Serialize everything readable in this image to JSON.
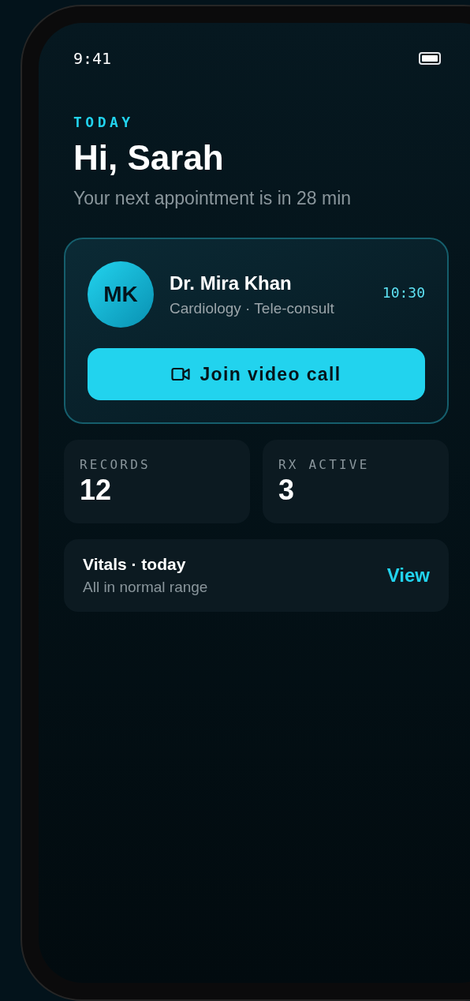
{
  "status_bar": {
    "time": "9:41"
  },
  "header": {
    "eyebrow": "TODAY",
    "greeting": "Hi, Sarah",
    "subtitle": "Your next appointment is in 28 min"
  },
  "appointment": {
    "initials": "MK",
    "doctor": "Dr. Mira Khan",
    "details": "Cardiology · Tele-consult",
    "time": "10:30",
    "action": "Join video call"
  },
  "stats": [
    {
      "label": "RECORDS",
      "value": "12"
    },
    {
      "label": "RX ACTIVE",
      "value": "3"
    }
  ],
  "vitals": {
    "title": "Vitals · today",
    "subtitle": "All in normal range",
    "action": "View"
  }
}
